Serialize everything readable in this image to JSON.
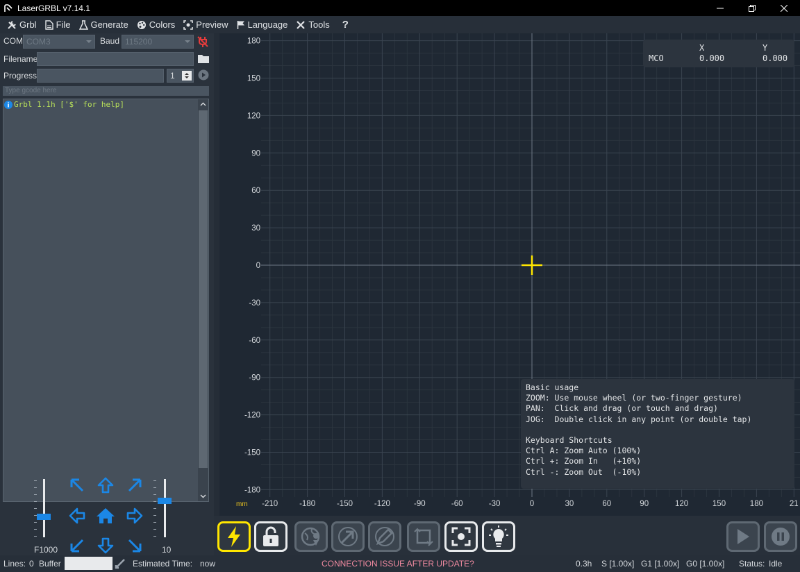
{
  "window": {
    "title": "LaserGRBL v7.14.1"
  },
  "menu": [
    {
      "label": "Grbl",
      "icon": "tools-icon"
    },
    {
      "label": "File",
      "icon": "file-icon"
    },
    {
      "label": "Generate",
      "icon": "flask-icon"
    },
    {
      "label": "Colors",
      "icon": "palette-icon"
    },
    {
      "label": "Preview",
      "icon": "preview-icon"
    },
    {
      "label": "Language",
      "icon": "flag-icon"
    },
    {
      "label": "Tools",
      "icon": "wrench-icon"
    },
    {
      "label": "?",
      "icon": ""
    }
  ],
  "connection": {
    "com_label": "COM",
    "com_value": "COM3",
    "baud_label": "Baud",
    "baud_value": "115200",
    "filename_label": "Filename",
    "filename_value": "",
    "progress_label": "Progress",
    "progress_copies": "1",
    "gcode_placeholder": "Type gcode here"
  },
  "console": {
    "lines": [
      "Grbl 1.1h ['$' for help]"
    ]
  },
  "jog": {
    "feed_label": "F1000",
    "step_label": "10",
    "feed_level": 0.36,
    "step_level": 0.63
  },
  "canvas": {
    "unit": "mm",
    "y_ticks": [
      "180",
      "150",
      "120",
      "90",
      "60",
      "30",
      "0",
      "-30",
      "-60",
      "-90",
      "-120",
      "-150",
      "-180"
    ],
    "x_ticks": [
      "-210",
      "-180",
      "-150",
      "-120",
      "-90",
      "-60",
      "-30",
      "0",
      "30",
      "60",
      "90",
      "120",
      "150",
      "180",
      "21"
    ],
    "coords": {
      "x_header": "X",
      "y_header": "Y",
      "row_label": "MCO",
      "x": "0.000",
      "y": "0.000"
    },
    "help": {
      "title": "Basic usage",
      "zoom": "ZOOM: Use mouse wheel (or two-finger gesture)",
      "pan": "PAN:  Click and drag (or touch and drag)",
      "jog": "JOG:  Double click in any point (or double tap)",
      "shortcuts_title": "Keyboard Shortcuts",
      "ctrl_a": "Ctrl A: Zoom Auto (100%)",
      "ctrl_plus": "Ctrl +: Zoom In   (+10%)",
      "ctrl_minus": "Ctrl -: Zoom Out  (-10%)"
    }
  },
  "status": {
    "lines_label": "Lines:",
    "lines_value": "0",
    "buffer_label": "Buffer",
    "est_label": "Estimated Time:",
    "est_value": "now",
    "warning": "CONNECTION ISSUE AFTER UPDATE?",
    "time": "0.3h",
    "s_override": "S [1.00x]",
    "g1_override": "G1 [1.00x]",
    "g0_override": "G0 [1.00x]",
    "status_label": "Status:",
    "status_value": "Idle"
  },
  "colors": {
    "accent": "#1b87e6",
    "crosshair": "#ffe600",
    "warning": "#f08aa0",
    "console_text": "#b8e05a"
  }
}
